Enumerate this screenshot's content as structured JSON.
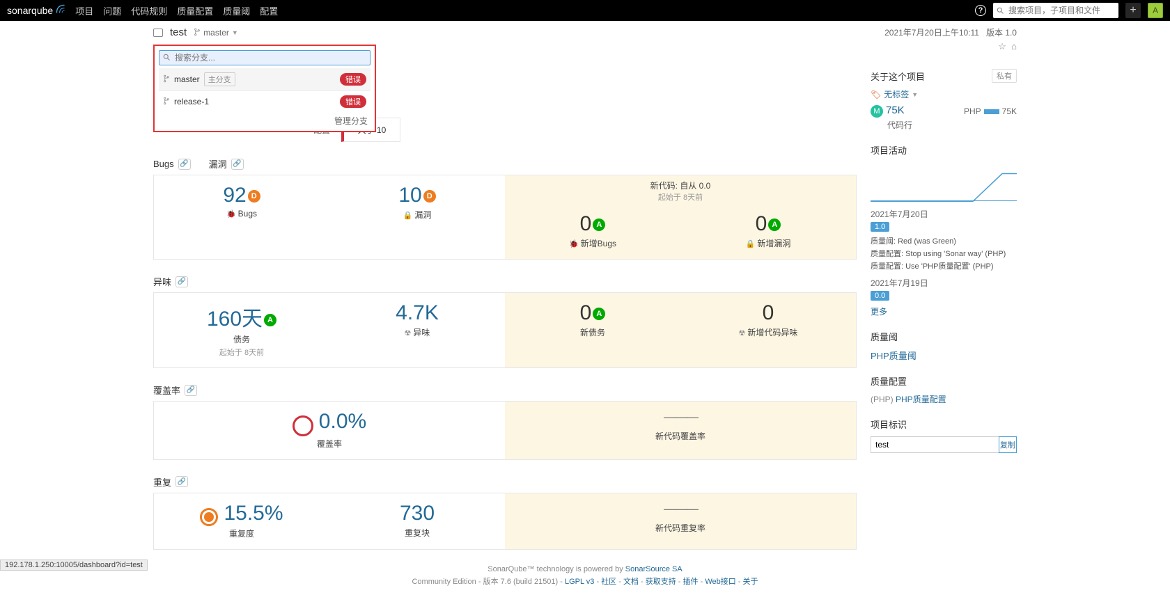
{
  "nav": {
    "logo_1": "sonar",
    "logo_2": "qube",
    "items": [
      "项目",
      "问题",
      "代码规则",
      "质量配置",
      "质量阈",
      "配置"
    ],
    "search_placeholder": "搜索项目，子项目和文件",
    "avatar": "A",
    "plus": "+",
    "help": "?"
  },
  "project": {
    "name": "test",
    "branch": "master",
    "timestamp": "2021年7月20日上午10:11",
    "version_label": "版本 1.0",
    "config_label": "配置"
  },
  "branch_dd": {
    "placeholder": "搜索分支...",
    "items": [
      {
        "name": "master",
        "main_tag": "主分支",
        "status": "错误"
      },
      {
        "name": "release-1",
        "main_tag": "",
        "status": "错误"
      }
    ],
    "manage": "管理分支"
  },
  "gate_fail": "大于 10",
  "sections": {
    "bugs": {
      "labels": [
        "Bugs",
        "漏洞"
      ],
      "new_header": "新代码: 自从 0.0",
      "new_sub": "起始于 8天前",
      "cells": [
        {
          "value": "92",
          "rating": "D",
          "label": "Bugs",
          "icon": "bug"
        },
        {
          "value": "10",
          "rating": "D",
          "label": "漏洞",
          "icon": "lock"
        }
      ],
      "new_cells": [
        {
          "value": "0",
          "rating": "A",
          "label": "新增Bugs",
          "icon": "bug"
        },
        {
          "value": "0",
          "rating": "A",
          "label": "新增漏洞",
          "icon": "lock"
        }
      ]
    },
    "smell": {
      "labels": [
        "异味"
      ],
      "cells": [
        {
          "value": "160天",
          "rating": "A",
          "label": "债务",
          "sub": "起始于 8天前"
        },
        {
          "value": "4.7K",
          "rating": "",
          "label": "异味",
          "icon": "radio"
        }
      ],
      "new_cells": [
        {
          "value": "0",
          "rating": "A",
          "label": "新债务"
        },
        {
          "value": "0",
          "rating": "",
          "label": "新增代码异味",
          "icon": "radio"
        }
      ]
    },
    "coverage": {
      "labels": [
        "覆盖率"
      ],
      "cells": [
        {
          "value": "0.0%",
          "label": "覆盖率"
        }
      ],
      "new_cells": [
        {
          "dash": true,
          "label": "新代码覆盖率"
        }
      ]
    },
    "dup": {
      "labels": [
        "重复"
      ],
      "cells": [
        {
          "value": "15.5%",
          "label": "重复度"
        },
        {
          "value": "730",
          "label": "重复块"
        }
      ],
      "new_cells": [
        {
          "dash": true,
          "label": "新代码重复率"
        }
      ]
    }
  },
  "sidebar": {
    "about": "关于这个项目",
    "private": "私有",
    "no_tag": "无标签",
    "loc_value": "75K",
    "loc_label": "代码行",
    "lang": "PHP",
    "lang_val": "75K",
    "activity_title": "项目活动",
    "events": [
      {
        "date": "2021年7月20日",
        "version": "1.0",
        "lines": [
          "质量阈: Red (was Green)",
          "质量配置: Stop using 'Sonar way' (PHP)",
          "质量配置: Use 'PHP质量配置' (PHP)"
        ]
      },
      {
        "date": "2021年7月19日",
        "version": "0.0",
        "lines": []
      }
    ],
    "more": "更多",
    "gate_title": "质量阈",
    "gate_link": "PHP质量阈",
    "profile_title": "质量配置",
    "profile_lang": "(PHP)",
    "profile_link": "PHP质量配置",
    "ident_title": "项目标识",
    "ident_value": "test",
    "copy": "复制"
  },
  "footer": {
    "line1_a": "SonarQube™ technology is powered by ",
    "line1_b": "SonarSource SA",
    "edition": "Community Edition",
    "version": "版本 7.6 (build 21501)",
    "links": [
      "LGPL v3",
      "社区",
      "文档",
      "获取支持",
      "插件",
      "Web接口",
      "关于"
    ]
  },
  "status_url": "192.178.1.250:10005/dashboard?id=test"
}
